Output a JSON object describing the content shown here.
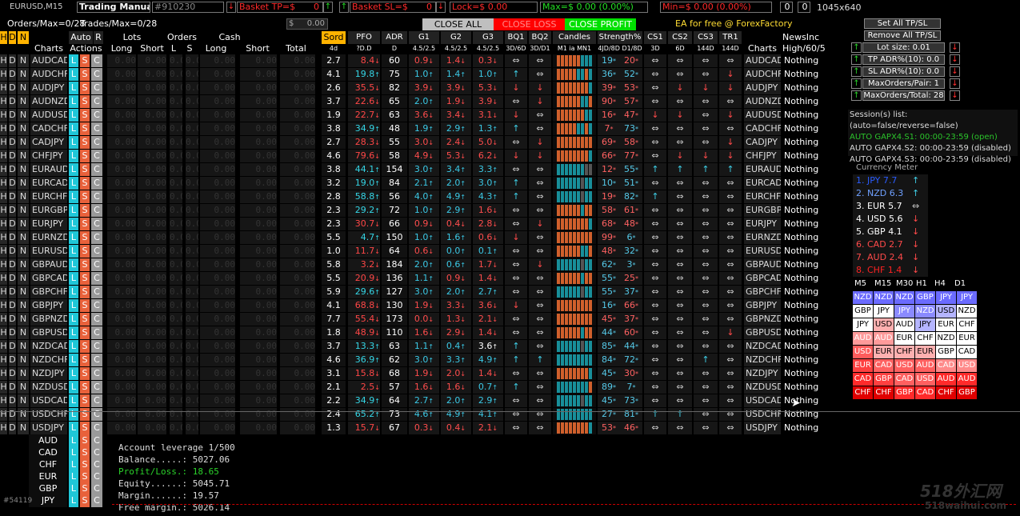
{
  "topbar": {
    "symbol": "EURUSD,M15",
    "trading_manual": "Trading Manual",
    "account": "#910230",
    "basket_tp_label": "Basket TP=$",
    "basket_tp_val": "0",
    "basket_sl_label": "Basket SL=$",
    "basket_sl_val": "0",
    "lock": "Lock=$ 0.00",
    "max": "Max=$ 0.00 (0.00%)",
    "min": "Min=$ 0.00 (0.00%)",
    "zero1": "0",
    "zero2": "0",
    "resolution": "1045x640"
  },
  "line2": {
    "orders": "Orders/Max=0/28",
    "trades": "Trades/Max=0/28",
    "dollar": "$",
    "cash_val": "0.00",
    "close_all": "CLOSE ALL",
    "close_loss": "CLOSE LOSS",
    "close_profit": "CLOSE PROFIT",
    "ea_free": "EA for free @ ForexFactory"
  },
  "header": {
    "hdn": [
      "H",
      "D",
      "N"
    ],
    "auto": "Auto",
    "r": "R",
    "lots": "Lots",
    "orders": "Orders",
    "cash": "Cash",
    "sord": "Sord",
    "pfo": "PFO",
    "adr": "ADR",
    "g1": "G1",
    "g2": "G2",
    "g3": "G3",
    "bq1": "BQ1",
    "bq2": "BQ2",
    "candles": "Candles",
    "strength": "Strength%",
    "cs1": "CS1",
    "cs2": "CS2",
    "cs3": "CS3",
    "tr1": "TR1",
    "newsinc": "NewsInc",
    "charts": "Charts",
    "actions": "Actions",
    "long": "Long",
    "short": "Short",
    "l": "L",
    "s": "S",
    "long2": "Long",
    "short2": "Short",
    "total": "Total",
    "sub_sord": "4d",
    "sub_pfo": "?D.D",
    "sub_adr": "D",
    "sub_g1": "4.5/2.5",
    "sub_g2": "4.5/2.5",
    "sub_g3": "4.5/2.5",
    "sub_bq1": "3D/6D",
    "sub_bq2": "3D/D1",
    "sub_candles": "M1 ia MN1",
    "sub_strength": "4JD/8D D1/8D",
    "sub_cs1": "3D",
    "sub_cs2": "6D",
    "sub_cs3": "144D",
    "sub_tr1": "144D",
    "charts2": "Charts",
    "high": "High/60/5"
  },
  "zero_val": "0.00",
  "rows": [
    {
      "pair": "AUDCAD",
      "sord": "2.7",
      "pfo": "8.4",
      "pfo_c": "r",
      "adr": "60",
      "g1": "0.9",
      "g1c": "r",
      "g2": "1.4",
      "g2c": "r",
      "g3": "0.3",
      "g3c": "r",
      "bq1": "⇔",
      "bq2": "⇔",
      "candles": "oooooottt",
      "s1": "19",
      "s1c": "c",
      "s2": "20",
      "s2c": "r",
      "cs1": "⇔",
      "cs2": "⇔",
      "cs3": "⇔",
      "tr1": "⇔",
      "news": "Nothing"
    },
    {
      "pair": "AUDCHF",
      "sord": "4.1",
      "pfo": "19.8",
      "pfo_c": "c",
      "adr": "75",
      "g1": "1.0",
      "g1c": "c",
      "g2": "1.4",
      "g2c": "c",
      "g3": "1.0",
      "g3c": "c",
      "bq1": "↑",
      "bq2": "⇔",
      "candles": "ooooottot",
      "s1": "36",
      "s1c": "c",
      "s2": "52",
      "s2c": "c",
      "cs1": "⇔",
      "cs2": "⇔",
      "cs3": "⇔",
      "tr1": "↓",
      "news": "Nothing"
    },
    {
      "pair": "AUDJPY",
      "sord": "2.6",
      "pfo": "35.5",
      "pfo_c": "r",
      "adr": "82",
      "g1": "3.9",
      "g1c": "r",
      "g2": "3.9",
      "g2c": "r",
      "g3": "5.3",
      "g3c": "r",
      "bq1": "↓",
      "bq2": "↓",
      "candles": "oooooooot",
      "s1": "39",
      "s1c": "r",
      "s2": "53",
      "s2c": "r",
      "cs1": "⇔",
      "cs2": "↓",
      "cs3": "↓",
      "tr1": "↓",
      "news": "Nothing"
    },
    {
      "pair": "AUDNZD",
      "sord": "3.7",
      "pfo": "22.6",
      "pfo_c": "r",
      "adr": "65",
      "g1": "2.0",
      "g1c": "c",
      "g2": "1.9",
      "g2c": "r",
      "g3": "3.9",
      "g3c": "r",
      "bq1": "⇔",
      "bq2": "↓",
      "candles": "ooooootto",
      "s1": "90",
      "s1c": "r",
      "s2": "57",
      "s2c": "r",
      "cs1": "⇔",
      "cs2": "⇔",
      "cs3": "⇔",
      "tr1": "⇔",
      "news": "Nothing"
    },
    {
      "pair": "AUDUSD",
      "sord": "1.9",
      "pfo": "22.7",
      "pfo_c": "r",
      "adr": "63",
      "g1": "3.6",
      "g1c": "r",
      "g2": "3.4",
      "g2c": "r",
      "g3": "3.1",
      "g3c": "r",
      "bq1": "↓",
      "bq2": "⇔",
      "candles": "ooooooott",
      "s1": "16",
      "s1c": "r",
      "s2": "47",
      "s2c": "r",
      "cs1": "↓",
      "cs2": "↓",
      "cs3": "⇔",
      "tr1": "↓",
      "news": "Nothing"
    },
    {
      "pair": "CADCHF",
      "sord": "3.8",
      "pfo": "34.9",
      "pfo_c": "c",
      "adr": "48",
      "g1": "1.9",
      "g1c": "c",
      "g2": "2.9",
      "g2c": "c",
      "g3": "1.3",
      "g3c": "c",
      "bq1": "↑",
      "bq2": "⇔",
      "candles": "ooooottot",
      "s1": "7",
      "s1c": "r",
      "s2": "73",
      "s2c": "c",
      "cs1": "⇔",
      "cs2": "⇔",
      "cs3": "⇔",
      "tr1": "⇔",
      "news": "Nothing"
    },
    {
      "pair": "CADJPY",
      "sord": "2.7",
      "pfo": "28.3",
      "pfo_c": "r",
      "adr": "55",
      "g1": "3.0",
      "g1c": "r",
      "g2": "2.4",
      "g2c": "r",
      "g3": "5.0",
      "g3c": "r",
      "bq1": "⇔",
      "bq2": "↓",
      "candles": "ooooooooo",
      "s1": "69",
      "s1c": "r",
      "s2": "58",
      "s2c": "r",
      "cs1": "⇔",
      "cs2": "⇔",
      "cs3": "⇔",
      "tr1": "↓",
      "news": "Nothing"
    },
    {
      "pair": "CHFJPY",
      "sord": "4.6",
      "pfo": "79.6",
      "pfo_c": "r",
      "adr": "58",
      "g1": "4.9",
      "g1c": "r",
      "g2": "5.3",
      "g2c": "r",
      "g3": "6.2",
      "g3c": "r",
      "bq1": "↓",
      "bq2": "↓",
      "candles": "oooooooot",
      "s1": "66",
      "s1c": "r",
      "s2": "77",
      "s2c": "r",
      "cs1": "⇔",
      "cs2": "↓",
      "cs3": "↓",
      "tr1": "↓",
      "news": "Nothing"
    },
    {
      "pair": "EURAUD",
      "sord": "3.8",
      "pfo": "44.1",
      "pfo_c": "c",
      "adr": "154",
      "g1": "3.0",
      "g1c": "c",
      "g2": "3.4",
      "g2c": "c",
      "g3": "3.3",
      "g3c": "c",
      "bq1": "⇔",
      "bq2": "⇔",
      "candles": "tttttttgg",
      "s1": "12",
      "s1c": "r",
      "s2": "55",
      "s2c": "c",
      "cs1": "↑",
      "cs2": "↑",
      "cs3": "↑",
      "tr1": "↑",
      "news": "Nothing"
    },
    {
      "pair": "EURCAD",
      "sord": "3.2",
      "pfo": "19.0",
      "pfo_c": "c",
      "adr": "84",
      "g1": "2.1",
      "g1c": "c",
      "g2": "2.0",
      "g2c": "c",
      "g3": "3.0",
      "g3c": "c",
      "bq1": "↑",
      "bq2": "⇔",
      "candles": "ttttttgtt",
      "s1": "10",
      "s1c": "c",
      "s2": "51",
      "s2c": "c",
      "cs1": "⇔",
      "cs2": "⇔",
      "cs3": "⇔",
      "tr1": "⇔",
      "news": "Nothing"
    },
    {
      "pair": "EURCHF",
      "sord": "2.8",
      "pfo": "58.8",
      "pfo_c": "c",
      "adr": "56",
      "g1": "4.0",
      "g1c": "c",
      "g2": "4.9",
      "g2c": "c",
      "g3": "4.3",
      "g3c": "c",
      "bq1": "↑",
      "bq2": "⇔",
      "candles": "ttttttgtt",
      "s1": "19",
      "s1c": "r",
      "s2": "82",
      "s2c": "c",
      "cs1": "↑",
      "cs2": "⇔",
      "cs3": "⇔",
      "tr1": "⇔",
      "news": "Nothing"
    },
    {
      "pair": "EURGBP",
      "sord": "2.3",
      "pfo": "29.2",
      "pfo_c": "c",
      "adr": "72",
      "g1": "1.0",
      "g1c": "c",
      "g2": "2.9",
      "g2c": "c",
      "g3": "1.6",
      "g3c": "r",
      "bq1": "⇔",
      "bq2": "⇔",
      "candles": "ooooootoo",
      "s1": "58",
      "s1c": "r",
      "s2": "61",
      "s2c": "r",
      "cs1": "⇔",
      "cs2": "⇔",
      "cs3": "⇔",
      "tr1": "⇔",
      "news": "Nothing"
    },
    {
      "pair": "EURJPY",
      "sord": "2.3",
      "pfo": "30.7",
      "pfo_c": "r",
      "adr": "66",
      "g1": "0.9",
      "g1c": "r",
      "g2": "0.4",
      "g2c": "r",
      "g3": "2.8",
      "g3c": "r",
      "bq1": "⇔",
      "bq2": "↓",
      "candles": "oooooooot",
      "s1": "68",
      "s1c": "r",
      "s2": "48",
      "s2c": "r",
      "cs1": "⇔",
      "cs2": "⇔",
      "cs3": "⇔",
      "tr1": "⇔",
      "news": "Nothing"
    },
    {
      "pair": "EURNZD",
      "sord": "5.5",
      "pfo": "4.7",
      "pfo_c": "c",
      "adr": "150",
      "g1": "1.0",
      "g1c": "c",
      "g2": "1.6",
      "g2c": "c",
      "g3": "0.6",
      "g3c": "r",
      "bq1": "↓",
      "bq2": "⇔",
      "candles": "ooooooooo",
      "s1": "99",
      "s1c": "r",
      "s2": "6",
      "s2c": "c",
      "cs1": "⇔",
      "cs2": "⇔",
      "cs3": "⇔",
      "tr1": "⇔",
      "news": "Nothing"
    },
    {
      "pair": "EURUSD",
      "sord": "1.0",
      "pfo": "11.7",
      "pfo_c": "r",
      "adr": "64",
      "g1": "0.6",
      "g1c": "r",
      "g2": "0.0",
      "g2c": "c",
      "g3": "0.1",
      "g3c": "c",
      "bq1": "⇔",
      "bq2": "⇔",
      "candles": "ooooootto",
      "s1": "48",
      "s1c": "r",
      "s2": "32",
      "s2c": "c",
      "cs1": "⇔",
      "cs2": "⇔",
      "cs3": "⇔",
      "tr1": "⇔",
      "news": "Nothing"
    },
    {
      "pair": "GBPAUD",
      "sord": "5.8",
      "pfo": "3.2",
      "pfo_c": "r",
      "adr": "184",
      "g1": "2.0",
      "g1c": "c",
      "g2": "0.6",
      "g2c": "c",
      "g3": "1.7",
      "g3c": "r",
      "bq1": "⇔",
      "bq2": "↓",
      "candles": "ttttttgtt",
      "s1": "62",
      "s1c": "c",
      "s2": "3",
      "s2c": "c",
      "cs1": "⇔",
      "cs2": "⇔",
      "cs3": "⇔",
      "tr1": "⇔",
      "news": "Nothing"
    },
    {
      "pair": "GBPCAD",
      "sord": "5.5",
      "pfo": "20.9",
      "pfo_c": "r",
      "adr": "136",
      "g1": "1.1",
      "g1c": "c",
      "g2": "0.9",
      "g2c": "r",
      "g3": "1.4",
      "g3c": "r",
      "bq1": "⇔",
      "bq2": "⇔",
      "candles": "ooooootoo",
      "s1": "55",
      "s1c": "c",
      "s2": "25",
      "s2c": "r",
      "cs1": "⇔",
      "cs2": "⇔",
      "cs3": "⇔",
      "tr1": "⇔",
      "news": "Nothing"
    },
    {
      "pair": "GBPCHF",
      "sord": "5.9",
      "pfo": "29.6",
      "pfo_c": "c",
      "adr": "127",
      "g1": "3.0",
      "g1c": "c",
      "g2": "2.0",
      "g2c": "c",
      "g3": "2.7",
      "g3c": "c",
      "bq1": "⇔",
      "bq2": "⇔",
      "candles": "ttttttgtt",
      "s1": "55",
      "s1c": "c",
      "s2": "37",
      "s2c": "c",
      "cs1": "⇔",
      "cs2": "⇔",
      "cs3": "⇔",
      "tr1": "⇔",
      "news": "Nothing"
    },
    {
      "pair": "GBPJPY",
      "sord": "4.1",
      "pfo": "68.8",
      "pfo_c": "r",
      "adr": "130",
      "g1": "1.9",
      "g1c": "r",
      "g2": "3.3",
      "g2c": "r",
      "g3": "3.6",
      "g3c": "r",
      "bq1": "↓",
      "bq2": "⇔",
      "candles": "ooooooooo",
      "s1": "16",
      "s1c": "c",
      "s2": "66",
      "s2c": "r",
      "cs1": "⇔",
      "cs2": "⇔",
      "cs3": "⇔",
      "tr1": "⇔",
      "news": "Nothing"
    },
    {
      "pair": "GBPNZD",
      "sord": "7.7",
      "pfo": "55.4",
      "pfo_c": "r",
      "adr": "173",
      "g1": "0.0",
      "g1c": "r",
      "g2": "1.3",
      "g2c": "r",
      "g3": "2.1",
      "g3c": "r",
      "bq1": "⇔",
      "bq2": "⇔",
      "candles": "ooooooooo",
      "s1": "45",
      "s1c": "r",
      "s2": "37",
      "s2c": "r",
      "cs1": "⇔",
      "cs2": "⇔",
      "cs3": "⇔",
      "tr1": "⇔",
      "news": "Nothing"
    },
    {
      "pair": "GBPUSD",
      "sord": "1.8",
      "pfo": "48.9",
      "pfo_c": "r",
      "adr": "110",
      "g1": "1.6",
      "g1c": "r",
      "g2": "2.9",
      "g2c": "r",
      "g3": "1.4",
      "g3c": "r",
      "bq1": "⇔",
      "bq2": "⇔",
      "candles": "ooooootoo",
      "s1": "44",
      "s1c": "c",
      "s2": "60",
      "s2c": "r",
      "cs1": "⇔",
      "cs2": "⇔",
      "cs3": "⇔",
      "tr1": "↓",
      "news": "Nothing"
    },
    {
      "pair": "NZDCAD",
      "sord": "3.7",
      "pfo": "13.3",
      "pfo_c": "c",
      "adr": "63",
      "g1": "1.1",
      "g1c": "c",
      "g2": "0.4",
      "g2c": "c",
      "g3": "3.6",
      "g3c": "w",
      "bq1": "↑",
      "bq2": "⇔",
      "candles": "ttttttgtt",
      "s1": "85",
      "s1c": "c",
      "s2": "44",
      "s2c": "c",
      "cs1": "⇔",
      "cs2": "⇔",
      "cs3": "⇔",
      "tr1": "⇔",
      "news": "Nothing"
    },
    {
      "pair": "NZDCHF",
      "sord": "4.6",
      "pfo": "36.9",
      "pfo_c": "c",
      "adr": "62",
      "g1": "3.0",
      "g1c": "c",
      "g2": "3.3",
      "g2c": "c",
      "g3": "4.9",
      "g3c": "c",
      "bq1": "↑",
      "bq2": "↑",
      "candles": "ttttttttt",
      "s1": "84",
      "s1c": "c",
      "s2": "72",
      "s2c": "c",
      "cs1": "⇔",
      "cs2": "⇔",
      "cs3": "↑",
      "tr1": "⇔",
      "news": "Nothing"
    },
    {
      "pair": "NZDJPY",
      "sord": "3.1",
      "pfo": "15.8",
      "pfo_c": "r",
      "adr": "68",
      "g1": "1.9",
      "g1c": "r",
      "g2": "2.0",
      "g2c": "r",
      "g3": "1.4",
      "g3c": "r",
      "bq1": "⇔",
      "bq2": "⇔",
      "candles": "oooooooot",
      "s1": "45",
      "s1c": "c",
      "s2": "30",
      "s2c": "r",
      "cs1": "⇔",
      "cs2": "⇔",
      "cs3": "⇔",
      "tr1": "⇔",
      "news": "Nothing"
    },
    {
      "pair": "NZDUSD",
      "sord": "2.1",
      "pfo": "2.5",
      "pfo_c": "r",
      "adr": "57",
      "g1": "1.6",
      "g1c": "r",
      "g2": "1.6",
      "g2c": "r",
      "g3": "0.7",
      "g3c": "c",
      "bq1": "↑",
      "bq2": "⇔",
      "candles": "tttttttto",
      "s1": "89",
      "s1c": "c",
      "s2": "7",
      "s2c": "c",
      "cs1": "⇔",
      "cs2": "⇔",
      "cs3": "⇔",
      "tr1": "⇔",
      "news": "Nothing"
    },
    {
      "pair": "USDCAD",
      "sord": "2.2",
      "pfo": "34.9",
      "pfo_c": "c",
      "adr": "64",
      "g1": "2.7",
      "g1c": "c",
      "g2": "2.0",
      "g2c": "c",
      "g3": "2.9",
      "g3c": "c",
      "bq1": "⇔",
      "bq2": "⇔",
      "candles": "ttttttgtt",
      "s1": "45",
      "s1c": "c",
      "s2": "73",
      "s2c": "c",
      "cs1": "⇔",
      "cs2": "⇔",
      "cs3": "⇔",
      "tr1": "⇔",
      "news": "Nothing"
    },
    {
      "pair": "USDCHF",
      "sord": "2.4",
      "pfo": "65.2",
      "pfo_c": "c",
      "adr": "73",
      "g1": "4.6",
      "g1c": "c",
      "g2": "4.9",
      "g2c": "c",
      "g3": "4.1",
      "g3c": "c",
      "bq1": "⇔",
      "bq2": "⇔",
      "candles": "ttttttttt",
      "s1": "27",
      "s1c": "c",
      "s2": "81",
      "s2c": "c",
      "cs1": "↑",
      "cs2": "↑",
      "cs3": "⇔",
      "tr1": "⇔",
      "news": "Nothing"
    },
    {
      "pair": "USDJPY",
      "sord": "1.3",
      "pfo": "15.7",
      "pfo_c": "r",
      "adr": "67",
      "g1": "0.3",
      "g1c": "r",
      "g2": "0.4",
      "g2c": "r",
      "g3": "2.1",
      "g3c": "r",
      "bq1": "⇔",
      "bq2": "⇔",
      "candles": "oooooooot",
      "s1": "53",
      "s1c": "r",
      "s2": "46",
      "s2c": "r",
      "cs1": "⇔",
      "cs2": "⇔",
      "cs3": "⇔",
      "tr1": "⇔",
      "news": "Nothing"
    }
  ],
  "right": {
    "set_all": "Set All TP/SL",
    "remove_all": "Remove All TP/SL",
    "lot": "Lot size: 0.01",
    "tp": "TP ADR%(10): 0.0",
    "sl": "SL ADR%(10): 0.0",
    "maxpair": "MaxOrders/Pair: 1",
    "maxtotal": "MaxOrders/Total: 28",
    "sessions_title": "Session(s) list: (auto=false/reverse=false)",
    "s1": "AUTO GAPX4.S1: 00:00-23:59 (open)",
    "s2": "AUTO GAPX4.S2: 00:00-23:59 (disabled)",
    "s3": "AUTO GAPX4.S3: 00:00-23:59 (disabled)",
    "meter_title": "Currency Meter",
    "meter": [
      {
        "t": "1. JPY 7.7",
        "a": "↑",
        "c": "#2a5cff"
      },
      {
        "t": "2. NZD 6.3",
        "a": "↑",
        "c": "#6fa0ff"
      },
      {
        "t": "3. EUR 5.7",
        "a": "⇔",
        "c": "#fff"
      },
      {
        "t": "4. USD 5.6",
        "a": "↓",
        "c": "#fff"
      },
      {
        "t": "5. GBP 4.1",
        "a": "↓",
        "c": "#fff"
      },
      {
        "t": "6. CAD 2.7",
        "a": "↓",
        "c": "#ff4a4a"
      },
      {
        "t": "7. AUD 2.4",
        "a": "↓",
        "c": "#ff4a4a"
      },
      {
        "t": "8. CHF 1.4",
        "a": "↓",
        "c": "#ff2222"
      }
    ],
    "tf": [
      "M5",
      "M15",
      "M30",
      "H1",
      "H4",
      "D1"
    ],
    "grid": [
      [
        "NZD",
        "NZD",
        "NZD",
        "GBP",
        "JPY",
        "JPY"
      ],
      [
        "GBP",
        "JPY",
        "JPY",
        "NZD",
        "USD",
        "NZD"
      ],
      [
        "JPY",
        "USD",
        "AUD",
        "JPY",
        "EUR",
        "CHF"
      ],
      [
        "AUD",
        "AUD",
        "EUR",
        "CHF",
        "NZD",
        "EUR"
      ],
      [
        "USD",
        "EUR",
        "CHF",
        "EUR",
        "GBP",
        "CAD"
      ],
      [
        "EUR",
        "CAD",
        "USD",
        "AUD",
        "CAD",
        "USD"
      ],
      [
        "CAD",
        "GBP",
        "CAD",
        "USD",
        "AUD",
        "AUD"
      ],
      [
        "CHF",
        "CHF",
        "GBP",
        "CAD",
        "CHF",
        "GBP"
      ]
    ],
    "gridcolors": [
      [
        "#6b6bff",
        "#6b6bff",
        "#6b6bff",
        "#6b6bff",
        "#6b6bff",
        "#6b6bff"
      ],
      [
        "#ffffff",
        "#ffffff",
        "#8a8aff",
        "#8a8aff",
        "#b5b5ff",
        "#ffffff"
      ],
      [
        "#ffffff",
        "#ffb0b0",
        "#ffffff",
        "#b5b5ff",
        "#ffffff",
        "#ffffff"
      ],
      [
        "#ff9a9a",
        "#ff9a9a",
        "#ffffff",
        "#ffffff",
        "#ffffff",
        "#ffffff"
      ],
      [
        "#ff5c5c",
        "#ffb0b0",
        "#ffb0b0",
        "#ffb0b0",
        "#ffffff",
        "#ffffff"
      ],
      [
        "#ff4040",
        "#ff6060",
        "#ff6060",
        "#ff6060",
        "#ff8a8a",
        "#ff8a8a"
      ],
      [
        "#ff2a2a",
        "#ff4040",
        "#ff6060",
        "#ff6060",
        "#ff2a2a",
        "#ff2a2a"
      ],
      [
        "#e00000",
        "#e00000",
        "#ff2a2a",
        "#ff2a2a",
        "#e00000",
        "#e00000"
      ]
    ]
  },
  "bottom": {
    "currencies": [
      "AUD",
      "CAD",
      "CHF",
      "EUR",
      "GBP",
      "JPY"
    ],
    "leverage": "Account leverage 1/500",
    "balance": "Balance.....: 5027.06",
    "pl": "Profit/Loss.: 18.65",
    "equity": "Equity......: 5045.71",
    "margin": "Margin......: 19.57",
    "free": "Free margin.: 5026.14",
    "id": "#54119",
    "watermark1": "518外汇网",
    "watermark2": "518waihui.com"
  }
}
